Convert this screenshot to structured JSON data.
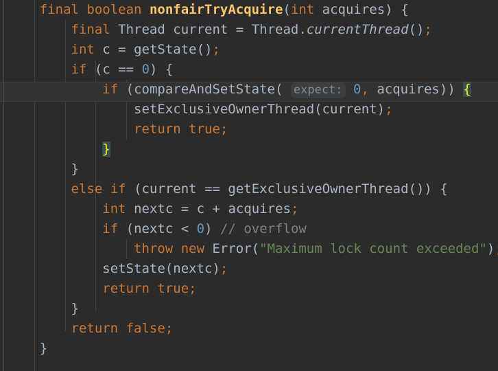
{
  "editor": {
    "language": "java",
    "theme": "darcula",
    "background_color": "#2b2b2b",
    "current_line_color": "#323232",
    "font_size_px": 19,
    "line_height_px": 29,
    "total_lines": 17,
    "current_line_number": 5,
    "colors": {
      "default_text": "#a9b7c6",
      "keyword": "#cc7832",
      "method_declaration": "#ffc66d",
      "number": "#6897bb",
      "string": "#6a8759",
      "comment": "#808080",
      "inlay_hint_text": "#878787",
      "inlay_hint_background": "#3b3f41",
      "brace_match_text": "#ffef28",
      "brace_match_background": "#3b514d",
      "indent_guide": "#4b4b4b"
    },
    "indent_guide_x": [
      5,
      50,
      95,
      139,
      184
    ],
    "matched_braces": [
      "{",
      "}"
    ],
    "inlay_hint": "expect:",
    "plain_text": "final boolean nonfairTryAcquire(int acquires) {\n    final Thread current = Thread.currentThread();\n    int c = getState();\n    if (c == 0) {\n        if (compareAndSetState( expect: 0, acquires)) {\n            setExclusiveOwnerThread(current);\n            return true;\n        }\n    }\n    else if (current == getExclusiveOwnerThread()) {\n        int nextc = c + acquires;\n        if (nextc < 0) // overflow\n            throw new Error(\"Maximum lock count exceeded\");\n        setState(nextc);\n        return true;\n    }\n    return false;\n}",
    "lines": [
      {
        "n": 1,
        "text": "    final boolean nonfairTryAcquire(int acquires) {"
      },
      {
        "n": 2,
        "text": "        final Thread current = Thread.currentThread();"
      },
      {
        "n": 3,
        "text": "        int c = getState();"
      },
      {
        "n": 4,
        "text": "        if (c == 0) {"
      },
      {
        "n": 5,
        "text": "            if (compareAndSetState( expect: 0, acquires)) {"
      },
      {
        "n": 6,
        "text": "                setExclusiveOwnerThread(current);"
      },
      {
        "n": 7,
        "text": "                return true;"
      },
      {
        "n": 8,
        "text": "            }"
      },
      {
        "n": 9,
        "text": "        }"
      },
      {
        "n": 10,
        "text": "        else if (current == getExclusiveOwnerThread()) {"
      },
      {
        "n": 11,
        "text": "            int nextc = c + acquires;"
      },
      {
        "n": 12,
        "text": "            if (nextc < 0) // overflow"
      },
      {
        "n": 13,
        "text": "                throw new Error(\"Maximum lock count exceeded\");"
      },
      {
        "n": 14,
        "text": "            setState(nextc);"
      },
      {
        "n": 15,
        "text": "            return true;"
      },
      {
        "n": 16,
        "text": "        }"
      },
      {
        "n": 17,
        "text": "        return false;"
      },
      {
        "n": 18,
        "text": "    }"
      }
    ],
    "tokens": {
      "kw_final": "final",
      "kw_boolean": "boolean",
      "kw_int": "int",
      "kw_if": "if",
      "kw_else": "else",
      "kw_return": "return",
      "kw_throw": "throw",
      "kw_new": "new",
      "kw_true": "true",
      "kw_false": "false",
      "method_name": "nonfairTryAcquire",
      "type_thread": "Thread",
      "type_error": "Error",
      "var_acquires": "acquires",
      "var_current": "current",
      "var_c": "c",
      "var_nextc": "nextc",
      "call_currentThread": "currentThread",
      "call_getState": "getState",
      "call_compareAndSetState": "compareAndSetState",
      "call_setExclusiveOwnerThread": "setExclusiveOwnerThread",
      "call_getExclusiveOwnerThread": "getExclusiveOwnerThread",
      "call_setState": "setState",
      "num_zero": "0",
      "string_error": "\"Maximum lock count exceeded\"",
      "comment_overflow": "// overflow",
      "hint_expect": "expect:",
      "open_brace": "{",
      "close_brace": "}"
    }
  }
}
